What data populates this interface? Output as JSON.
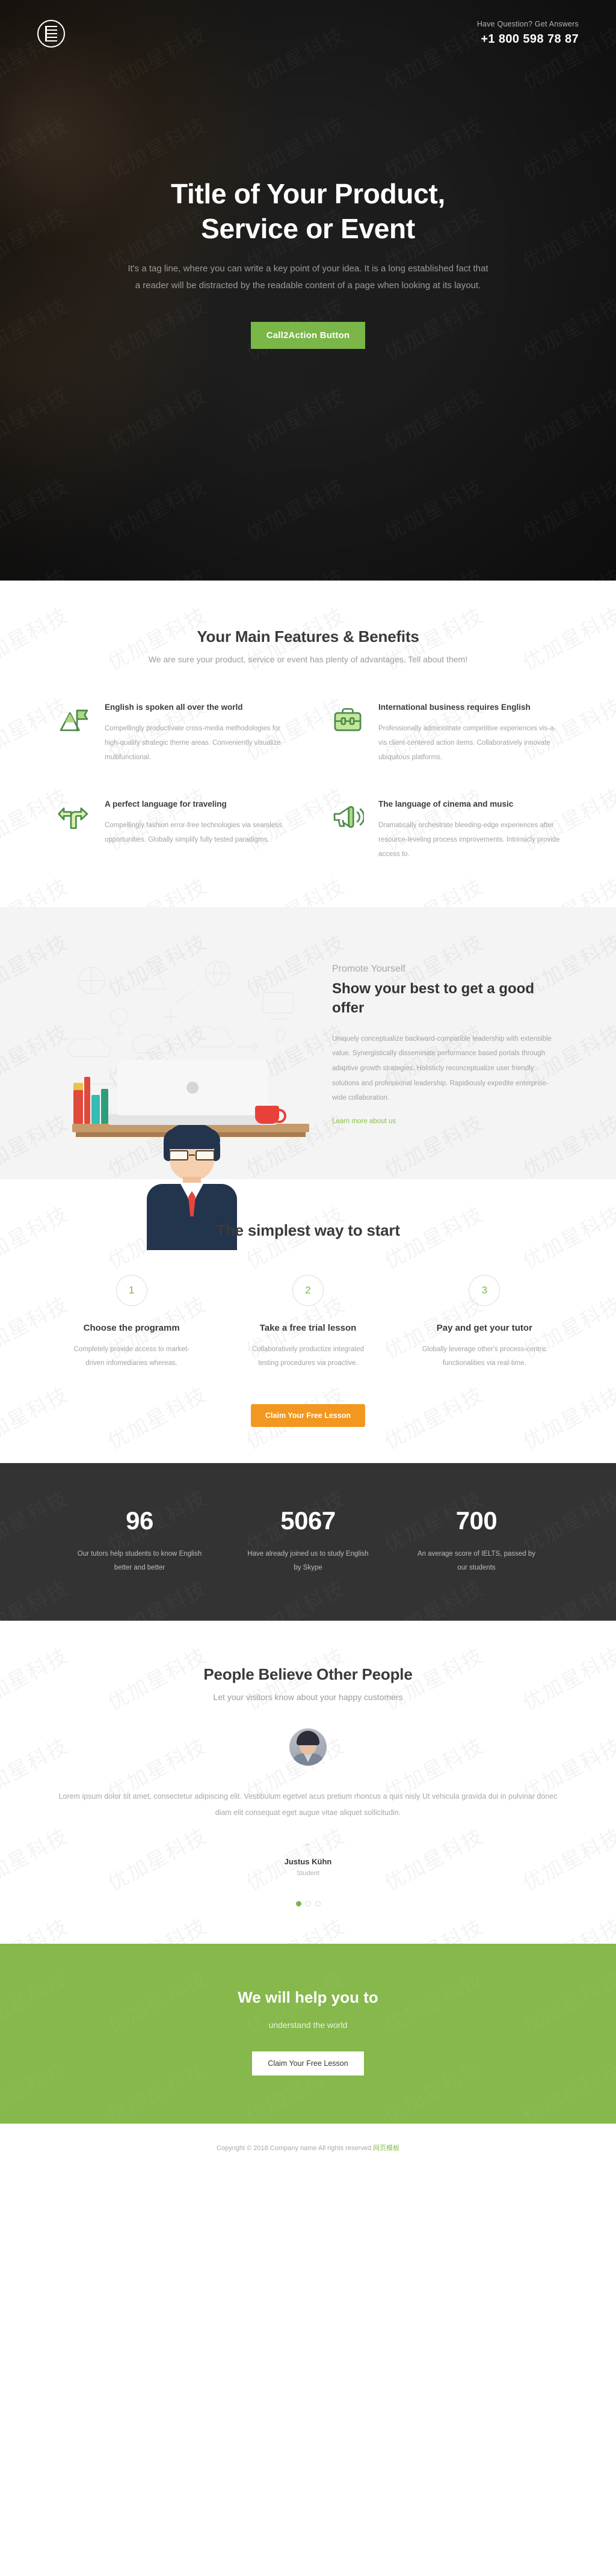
{
  "header": {
    "logo_icon": "logo-monogram-icon",
    "question_label": "Have Question? Get Answers",
    "phone": "+1 800 598 78 87"
  },
  "hero": {
    "title_line1": "Title of Your Product,",
    "title_line2": "Service or Event",
    "subtitle": "It's a tag line, where you can write a key point of your idea. It is a long established fact that a reader will be distracted by the readable content of a page when looking at its layout.",
    "cta_label": "Call2Action Button",
    "cta_color": "#7ab648"
  },
  "features": {
    "title": "Your Main Features & Benefits",
    "subtitle": "We are sure your product, service or event has plenty of advantages. Tell about them!",
    "items": [
      {
        "icon": "mountain-flag-icon",
        "title": "English is spoken all over the world",
        "text": "Compellingly productivate cross-media methodologies for high-quality strategic theme areas. Conveniently visualize multifunctional."
      },
      {
        "icon": "briefcase-icon",
        "title": "International business requires English",
        "text": "Professionally administrate competitive experiences vis-a-vis client-centered action items. Collaboratively innovate ubiquitous platforms."
      },
      {
        "icon": "direction-arrows-icon",
        "title": "A perfect language for traveling",
        "text": "Compellingly fashion error-free technologies via seamless opportunities. Globally simplify fully tested paradigms."
      },
      {
        "icon": "megaphone-icon",
        "title": "The language of cinema and music",
        "text": "Dramatically orchestrate bleeding-edge experiences after resource-leveling process improvements. Intrinsicly provide access to."
      }
    ]
  },
  "promote": {
    "eyebrow": "Promote Yourself",
    "title": "Show your best to get a good offer",
    "text": "Uniquely conceptualize backward-compatible leadership with extensible value. Synergistically disseminate performance based portals through adaptive growth strategies. Holisticly reconceptualize user friendly solutions and professional leadership. Rapidiously expedite enterprise-wide collaboration.",
    "link_label": "Learn more about us",
    "illustration": "businessman-at-laptop-illustration"
  },
  "steps": {
    "title": "The simplest way to start",
    "items": [
      {
        "number": "1",
        "title": "Choose the programm",
        "text": "Completely provide access to market-driven infomediaries whereas."
      },
      {
        "number": "2",
        "title": "Take a free trial lesson",
        "text": "Collaboratively productize integrated testing procedures via proactive."
      },
      {
        "number": "3",
        "title": "Pay and get your tutor",
        "text": "Globally leverage other's process-centric functionalities via real-time."
      }
    ],
    "cta_label": "Claim Your Free Lesson",
    "cta_color": "#f2971f"
  },
  "stats": {
    "items": [
      {
        "number": "96",
        "label": "Our tutors help students to know English better and better"
      },
      {
        "number": "5067",
        "label": "Have already joined us to study English by Skype"
      },
      {
        "number": "700",
        "label": "An average score of IELTS, passed by our students"
      }
    ]
  },
  "testimonials": {
    "title": "People Believe Other People",
    "subtitle": "Let your visitors know about your happy customers",
    "avatar": "customer-avatar",
    "quote": "Lorem ipsum dolor sit amet, consectetur adipiscing elit. Vestibulum egetvel acus pretium rhoncus a quis nisly Ut vehicula gravida dui in pulvinar donec diam elit consequat eget augue vitae aliquet sollicitudin.",
    "dash": "–",
    "author": "Justus Kühn",
    "role": "Student",
    "dots": [
      true,
      false,
      false
    ]
  },
  "cta": {
    "title": "We will help you to",
    "subtitle": "understand the world",
    "button_label": "Claim Your Free Lesson",
    "background": "#86b84c"
  },
  "footer": {
    "copyright": "Copyright © 2018.Company name All rights reserved.",
    "link_label": "网页模板"
  },
  "watermark": {
    "text": "优加星科技"
  }
}
